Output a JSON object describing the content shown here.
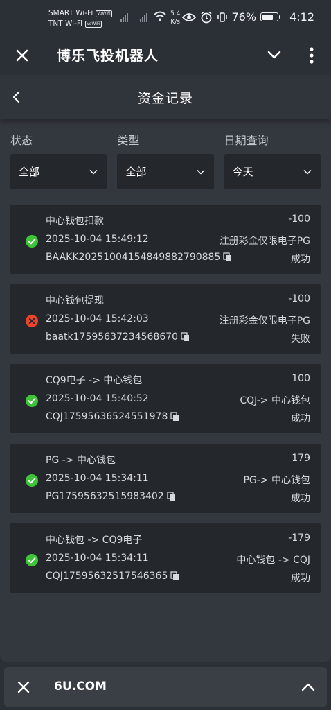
{
  "status_bar": {
    "sim1": "SMART Wi-Fi",
    "sim2": "TNT Wi-Fi",
    "volte": "VoWiFi",
    "speed_value": "5.4",
    "speed_unit": "K/s",
    "battery_percent": "76%",
    "battery_level": 0.76,
    "time": "4:12",
    "icons": [
      "signal-icon",
      "wifi-icon",
      "eye-icon",
      "alarm-icon",
      "vibrate-icon",
      "battery-icon"
    ]
  },
  "app_bar": {
    "title": "博乐飞投机器人",
    "icons": [
      "close-icon",
      "chevron-down-icon",
      "more-vertical-icon"
    ]
  },
  "page": {
    "title": "资金记录",
    "back_icon": "chevron-left-icon"
  },
  "filters": [
    {
      "label": "状态",
      "value": "全部"
    },
    {
      "label": "类型",
      "value": "全部"
    },
    {
      "label": "日期查询",
      "value": "今天"
    }
  ],
  "records": [
    {
      "title": "中心钱包扣款",
      "time": "2025-10-04 15:49:12",
      "order_no": "BAAKK20251004154849882790885",
      "amount": "-100",
      "remark": "注册彩金仅限电子PG",
      "result": "成功",
      "status": "success"
    },
    {
      "title": "中心钱包提现",
      "time": "2025-10-04 15:42:03",
      "order_no": "baatk17595637234568670",
      "amount": "-100",
      "remark": "注册彩金仅限电子PG",
      "result": "失败",
      "status": "fail"
    },
    {
      "title": "CQ9电子 -> 中心钱包",
      "time": "2025-10-04 15:40:52",
      "order_no": "CQJ17595636524551978",
      "amount": "100",
      "remark": "CQJ-> 中心钱包",
      "result": "成功",
      "status": "success"
    },
    {
      "title": "PG -> 中心钱包",
      "time": "2025-10-04 15:34:11",
      "order_no": "PG17595632515983402",
      "amount": "179",
      "remark": "PG-> 中心钱包",
      "result": "成功",
      "status": "success"
    },
    {
      "title": "中心钱包 -> CQ9电子",
      "time": "2025-10-04 15:34:11",
      "order_no": "CQJ17595632517546365",
      "amount": "-179",
      "remark": "中心钱包 -> CQJ",
      "result": "成功",
      "status": "success"
    }
  ],
  "bottom_bar": {
    "domain": "6U.COM"
  },
  "colors": {
    "success": "#3fc33a",
    "fail": "#e8452c",
    "card_bg": "#24272c",
    "page_bg": "#33373e"
  }
}
